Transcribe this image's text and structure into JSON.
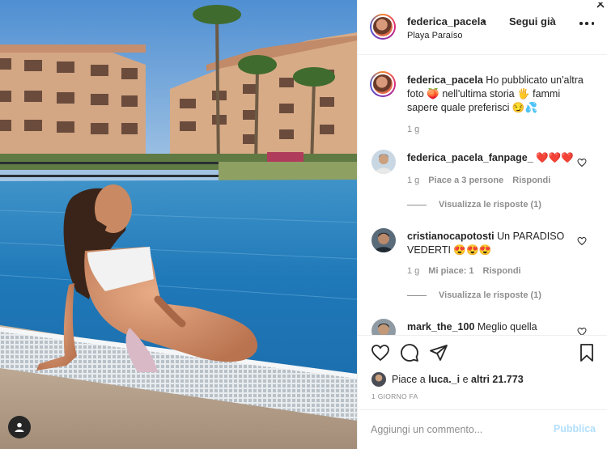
{
  "post": {
    "username": "federica_pacela",
    "follow_label": "Segui già",
    "location": "Playa Paraíso"
  },
  "caption": {
    "username": "federica_pacela",
    "text": "Ho pubblicato un'altra foto 🍑 nell'ultima storia 🖐 fammi sapere quale preferisci 😏💦",
    "time": "1 g"
  },
  "comments": [
    {
      "username": "federica_pacela_fanpage_",
      "text": "❤️❤️❤️",
      "time": "1 g",
      "likes": "Piace a 3 persone",
      "reply": "Rispondi",
      "view_replies": "Visualizza le risposte (1)"
    },
    {
      "username": "cristianocapotosti",
      "text": "Un PARADISO VEDERTI 😍😍😍",
      "time": "1 g",
      "likes": "Mi piace: 1",
      "reply": "Rispondi",
      "view_replies": "Visualizza le risposte (1)"
    },
    {
      "username": "mark_the_100",
      "text": "Meglio quella"
    }
  ],
  "likes": {
    "prefix": "Piace a",
    "user": "luca._i",
    "middle": "e",
    "others": "altri 21.773"
  },
  "posted": "1 GIORNO FA",
  "add_comment": {
    "placeholder": "Aggiungi un commento...",
    "publish_label": "Pubblica"
  },
  "icons": [
    "heart-icon",
    "comment-icon",
    "share-icon",
    "bookmark-icon",
    "more-icon",
    "user-tag-icon"
  ],
  "colors": {
    "link_disabled": "#b2dffc",
    "muted": "#8e8e8e",
    "text": "#262626",
    "heart_red": "#b5121b"
  }
}
